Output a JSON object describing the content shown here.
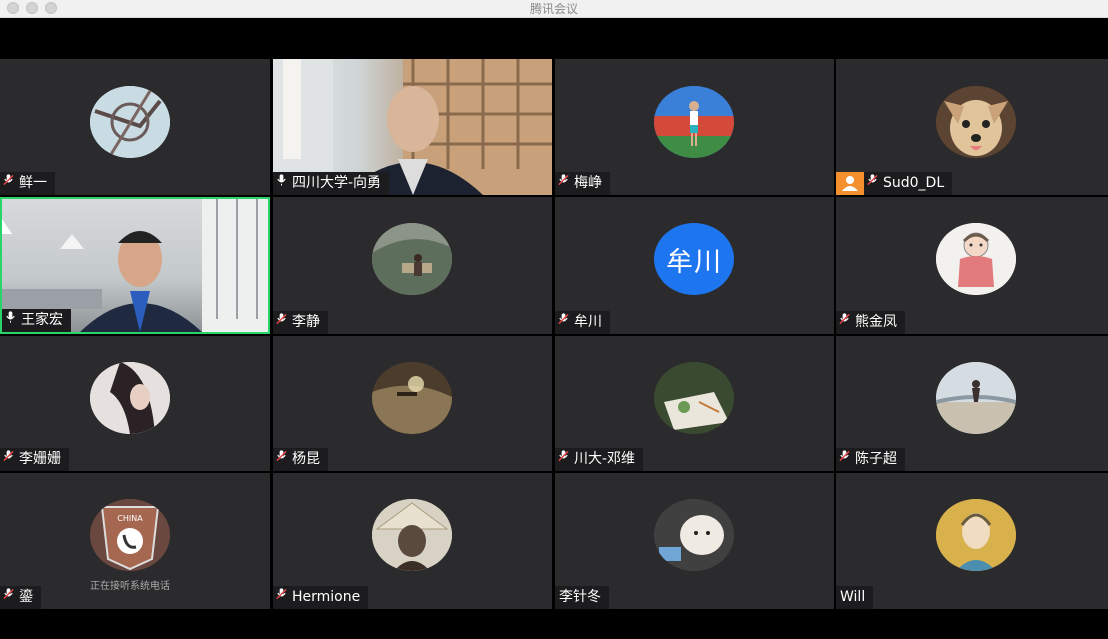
{
  "window": {
    "title": "腾讯会议"
  },
  "participants": [
    {
      "name": "鲜一",
      "muted": true,
      "kind": "avatar"
    },
    {
      "name": "四川大学-向勇",
      "muted": false,
      "kind": "video"
    },
    {
      "name": "梅峥",
      "muted": true,
      "kind": "avatar"
    },
    {
      "name": "Sud0_DL",
      "muted": true,
      "kind": "avatar",
      "host": true
    },
    {
      "name": "王家宏",
      "muted": false,
      "kind": "video",
      "speaking": true
    },
    {
      "name": "李静",
      "muted": true,
      "kind": "avatar"
    },
    {
      "name": "牟川",
      "muted": true,
      "kind": "text-avatar",
      "avatar_text": "牟川"
    },
    {
      "name": "熊金凤",
      "muted": true,
      "kind": "avatar"
    },
    {
      "name": "李姗姗",
      "muted": true,
      "kind": "avatar"
    },
    {
      "name": "杨昆",
      "muted": true,
      "kind": "avatar"
    },
    {
      "name": "川大-邓维",
      "muted": true,
      "kind": "avatar"
    },
    {
      "name": "陈子超",
      "muted": true,
      "kind": "avatar"
    },
    {
      "name": "鎏",
      "muted": true,
      "kind": "avatar",
      "status": "正在接听系统电话"
    },
    {
      "name": "Hermione",
      "muted": true,
      "kind": "avatar"
    },
    {
      "name": "李针冬",
      "muted": null,
      "kind": "avatar"
    },
    {
      "name": "Will",
      "muted": null,
      "kind": "avatar"
    }
  ],
  "colors": {
    "tile_bg": "#2b2b2d",
    "active_border": "#2bd36b",
    "text_avatar_bg": "#1e75f0",
    "host_badge": "#f5902e"
  }
}
